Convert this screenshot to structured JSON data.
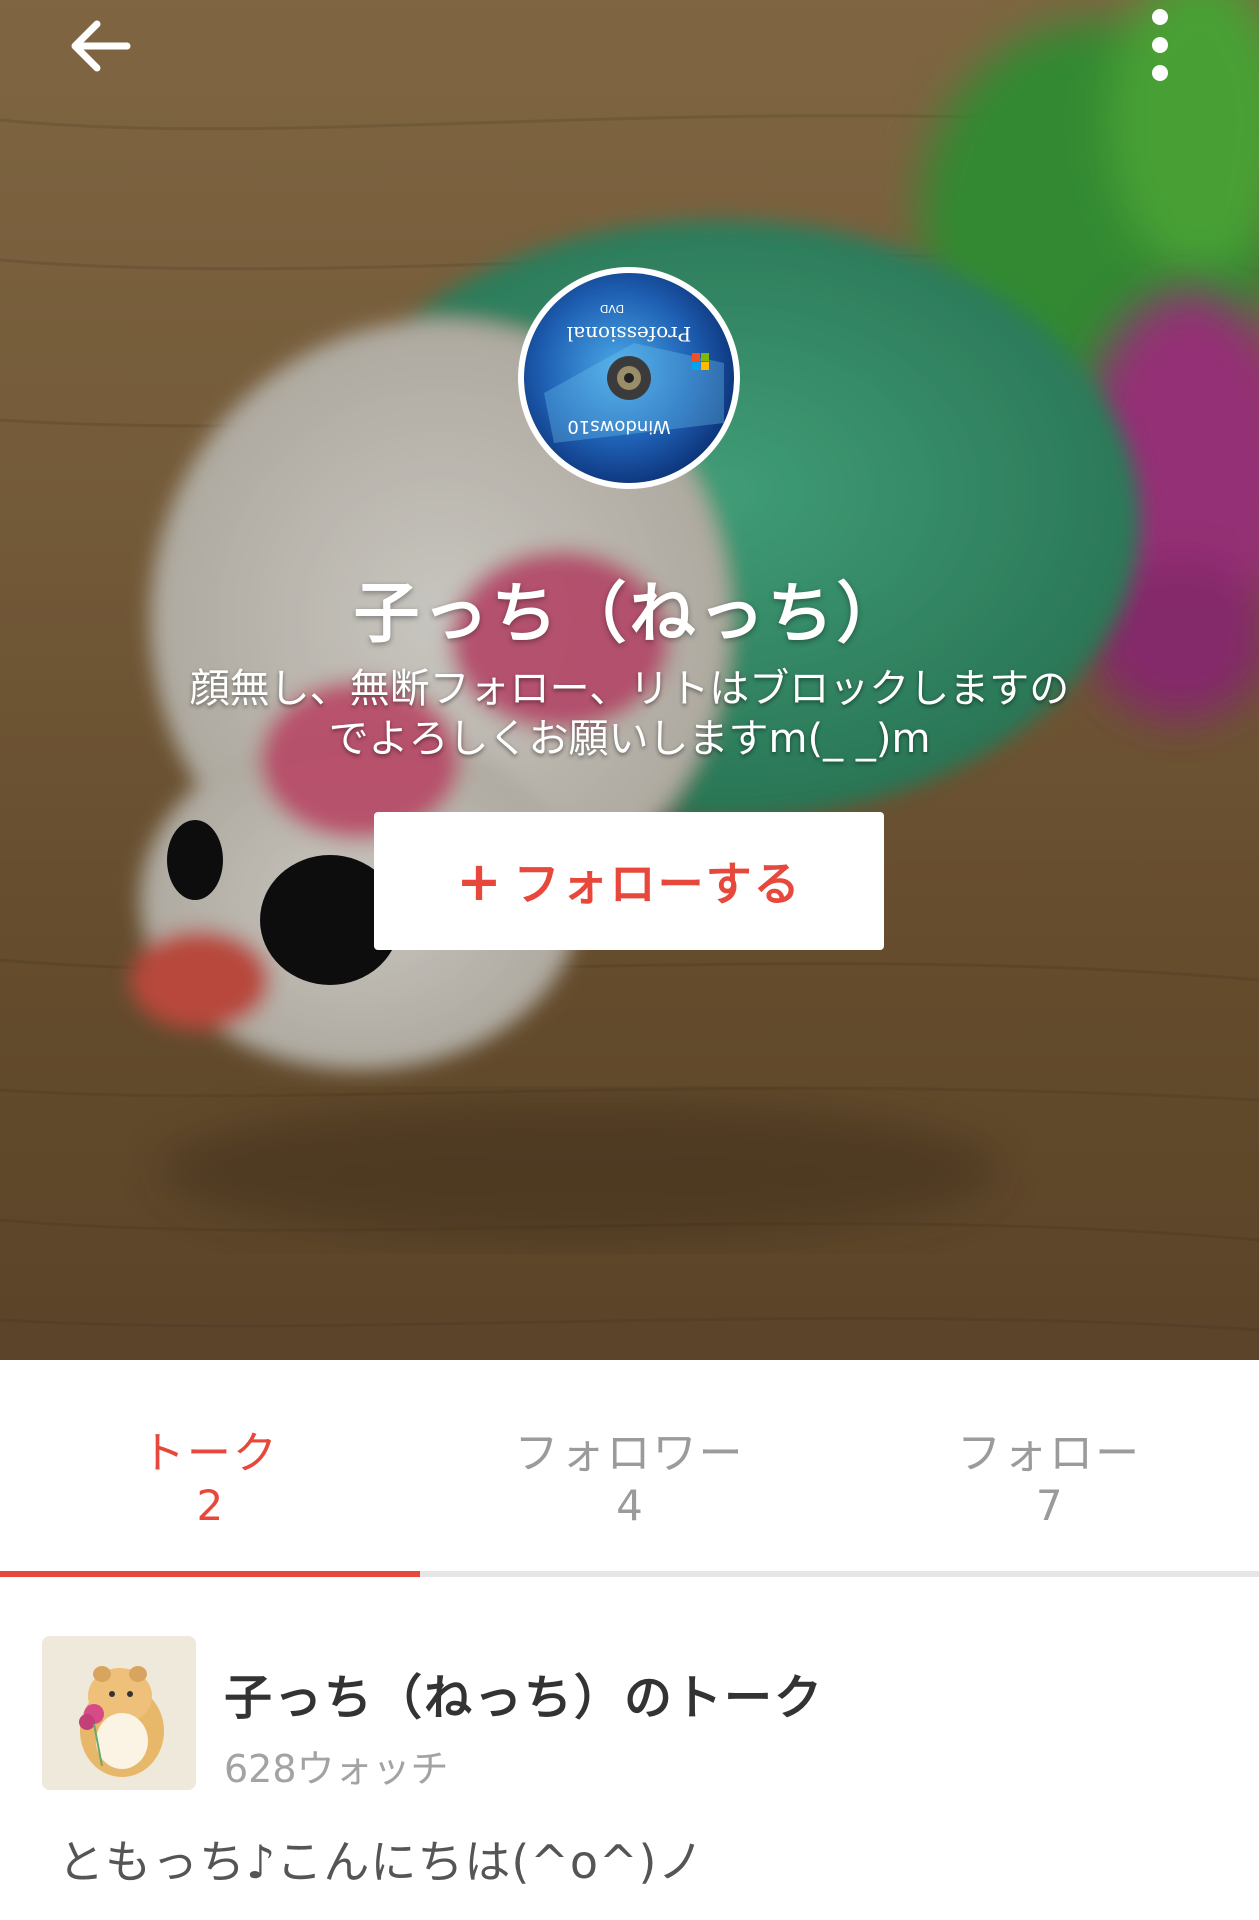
{
  "header": {
    "back_icon": "arrow-left-icon",
    "more_icon": "more-vertical-icon"
  },
  "profile": {
    "name": "子っち（ねっち）",
    "bio_line1": "顔無し、無断フォロー、リトはブロックしますの",
    "bio_line2": "でよろしくお願いしますm(_ _)m",
    "avatar_lettering": [
      "Professional",
      "Windows10",
      "DVD"
    ],
    "follow_button": {
      "icon": "+",
      "label": "フォローする"
    }
  },
  "tabs": [
    {
      "label": "トーク",
      "count": "2",
      "active": true
    },
    {
      "label": "フォロワー",
      "count": "4",
      "active": false
    },
    {
      "label": "フォロー",
      "count": "7",
      "active": false
    }
  ],
  "talk": {
    "title": "子っち（ねっち）のトーク",
    "watch_count": "628ウォッチ",
    "preview": "ともっち♪こんにちは(^o^)ノ"
  },
  "colors": {
    "accent": "#e8483b",
    "tab_inactive": "#9b9b9b",
    "title_text": "#333333",
    "muted_text": "#a3a3a3"
  }
}
